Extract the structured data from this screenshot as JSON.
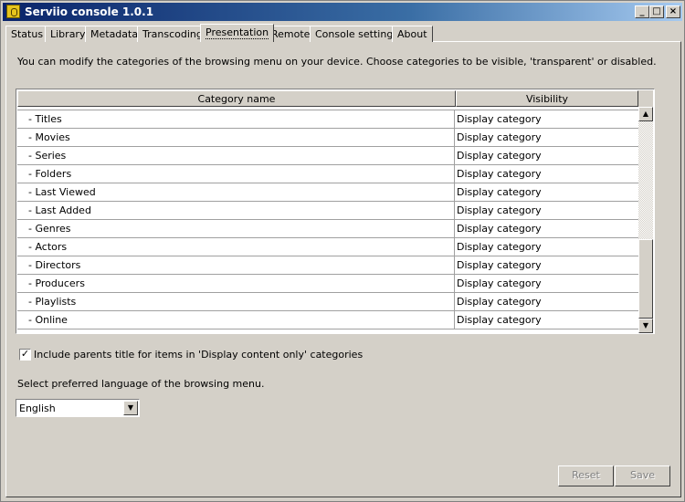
{
  "window": {
    "title": "Serviio console 1.0.1"
  },
  "titlebar_buttons": {
    "minimize": "_",
    "maximize": "□",
    "close": "×"
  },
  "tabs": [
    {
      "label": "Status"
    },
    {
      "label": "Library"
    },
    {
      "label": "Metadata"
    },
    {
      "label": "Transcoding"
    },
    {
      "label": "Presentation",
      "active": true
    },
    {
      "label": "Remote"
    },
    {
      "label": "Console settings"
    },
    {
      "label": "About"
    }
  ],
  "presentation": {
    "description": "You can modify the categories of the browsing menu on your device. Choose categories to be visible, 'transparent' or disabled.",
    "table": {
      "columns": [
        "Category name",
        "Visibility"
      ],
      "rows": [
        {
          "name": " - Titles",
          "visibility": "Display category"
        },
        {
          "name": " - Movies",
          "visibility": "Display category"
        },
        {
          "name": " - Series",
          "visibility": "Display category"
        },
        {
          "name": " - Folders",
          "visibility": "Display category"
        },
        {
          "name": " - Last Viewed",
          "visibility": "Display category"
        },
        {
          "name": " - Last Added",
          "visibility": "Display category"
        },
        {
          "name": " - Genres",
          "visibility": "Display category"
        },
        {
          "name": " - Actors",
          "visibility": "Display category"
        },
        {
          "name": " - Directors",
          "visibility": "Display category"
        },
        {
          "name": " - Producers",
          "visibility": "Display category"
        },
        {
          "name": " - Playlists",
          "visibility": "Display category"
        },
        {
          "name": " - Online",
          "visibility": "Display category"
        }
      ]
    },
    "include_parents": {
      "label": "Include parents title for items in 'Display content only' categories",
      "checked": true
    },
    "language": {
      "label": "Select preferred language of the browsing menu.",
      "selected": "English"
    },
    "buttons": {
      "reset": "Reset",
      "save": "Save"
    }
  },
  "icons": {
    "app": "serviio-logo-icon",
    "scroll_up": "▲",
    "scroll_down": "▼",
    "dropdown": "▼",
    "check": "✓"
  }
}
